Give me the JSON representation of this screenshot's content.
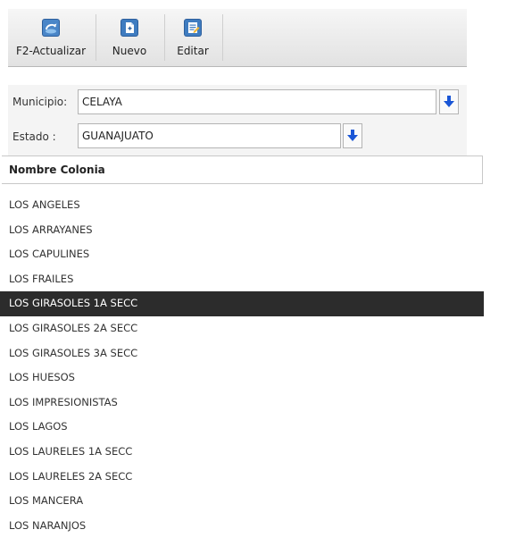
{
  "toolbar": {
    "refresh_label": "F2-Actualizar",
    "new_label": "Nuevo",
    "edit_label": "Editar"
  },
  "form": {
    "municipio_label": "Municipio:",
    "municipio_value": "CELAYA",
    "estado_label": "Estado :",
    "estado_value": "GUANAJUATO"
  },
  "list": {
    "header": "Nombre Colonia",
    "selected_index": 4,
    "items": [
      "LOS ANGELES",
      "LOS ARRAYANES",
      "LOS CAPULINES",
      "LOS FRAILES",
      "LOS GIRASOLES 1A SECC",
      "LOS GIRASOLES 2A SECC",
      "LOS GIRASOLES 3A SECC",
      "LOS HUESOS",
      "LOS IMPRESIONISTAS",
      "LOS LAGOS",
      "LOS LAURELES 1A SECC",
      "LOS LAURELES 2A SECC",
      "LOS MANCERA",
      "LOS NARANJOS"
    ]
  },
  "colors": {
    "selected_bg": "#2c2c2c",
    "arrow_blue": "#1a56d6"
  }
}
